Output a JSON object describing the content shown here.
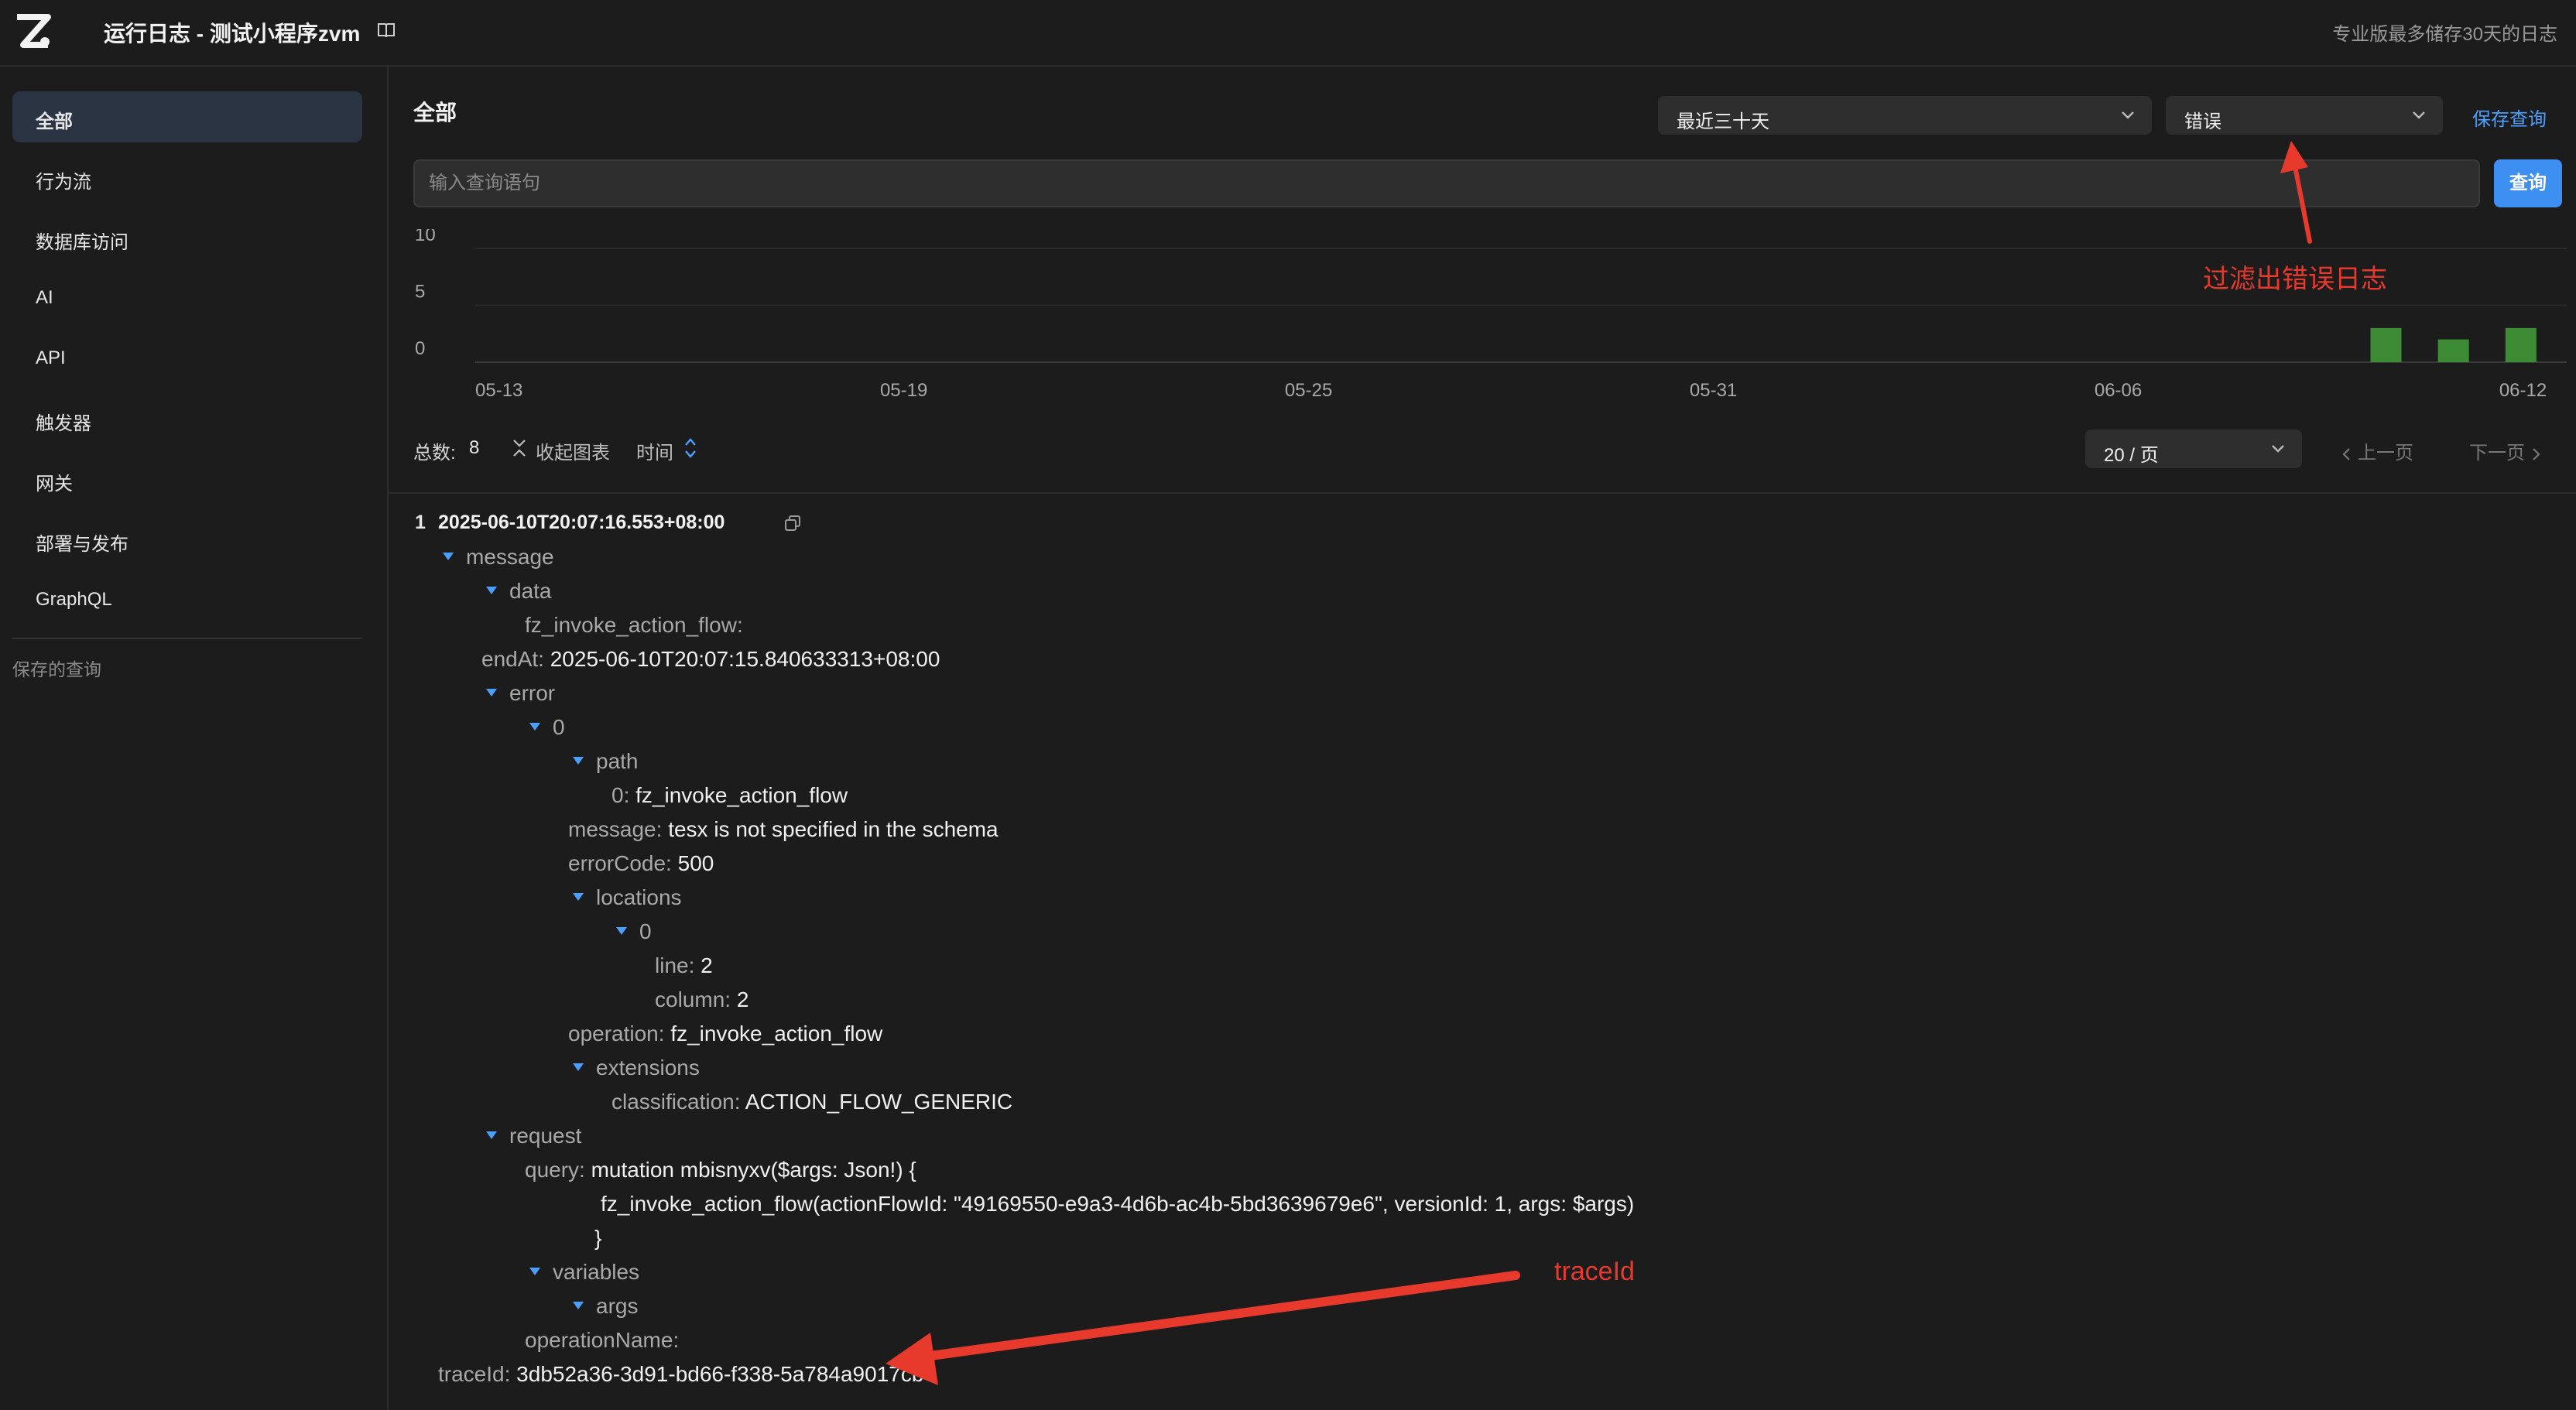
{
  "header": {
    "title": "运行日志 - 测试小程序zvm",
    "retention_note": "专业版最多储存30天的日志"
  },
  "sidebar": {
    "items": [
      {
        "label": "全部",
        "active": true
      },
      {
        "label": "行为流"
      },
      {
        "label": "数据库访问"
      },
      {
        "label": "AI"
      },
      {
        "label": "API"
      },
      {
        "label": "触发器"
      },
      {
        "label": "网关"
      },
      {
        "label": "部署与发布"
      },
      {
        "label": "GraphQL"
      }
    ],
    "saved_queries_label": "保存的查询"
  },
  "main": {
    "title": "全部",
    "time_range": "最近三十天",
    "level_filter": "错误",
    "save_query": "保存查询",
    "query_placeholder": "输入查询语句",
    "query_button": "查询"
  },
  "chart_data": {
    "type": "bar",
    "y_ticks": [
      "10",
      "5",
      "0"
    ],
    "ylim": [
      0,
      10
    ],
    "x_tick_labels": [
      "05-13",
      "05-19",
      "05-25",
      "05-31",
      "06-06",
      "06-12"
    ],
    "x_start": "05-13",
    "x_end": "06-13",
    "bars": [
      {
        "date": "06-10",
        "value": 3
      },
      {
        "date": "06-11",
        "value": 2
      },
      {
        "date": "06-12",
        "value": 3
      }
    ],
    "bar_color": "#3d8c35",
    "grid": true
  },
  "toolbar": {
    "total_label": "总数:",
    "total_count": "8",
    "collapse_chart": "收起图表",
    "time_sort": "时间",
    "page_size": "20 / 页",
    "prev_page": "上一页",
    "next_page": "下一页"
  },
  "annotations": {
    "filter_note": "过滤出错误日志",
    "trace_note": "traceId"
  },
  "log": {
    "index": "1",
    "timestamp": "2025-06-10T20:07:16.553+08:00",
    "k_message": "message",
    "k_data": "data",
    "k_fz_flow": "fz_invoke_action_flow:",
    "k_endAt": "endAt:",
    "v_endAt": "2025-06-10T20:07:15.840633313+08:00",
    "k_error": "error",
    "k_0": "0",
    "k_path": "path",
    "k_path0": "0:",
    "v_path0": "fz_invoke_action_flow",
    "k_err_message": "message:",
    "v_err_message": "tesx is not specified in the schema",
    "k_errorCode": "errorCode:",
    "v_errorCode": "500",
    "k_locations": "locations",
    "k_loc0": "0",
    "k_line": "line:",
    "v_line": "2",
    "k_column": "column:",
    "v_column": "2",
    "k_operation": "operation:",
    "v_operation": "fz_invoke_action_flow",
    "k_extensions": "extensions",
    "k_classification": "classification:",
    "v_classification": "ACTION_FLOW_GENERIC",
    "k_request": "request",
    "k_query": "query:",
    "v_query1": "mutation mbisnyxv($args: Json!) {",
    "v_query2": "fz_invoke_action_flow(actionFlowId: \"49169550-e9a3-4d6b-ac4b-5bd3639679e6\", versionId: 1, args: $args)",
    "v_query3": "}",
    "k_variables": "variables",
    "k_args": "args",
    "k_operationName": "operationName:",
    "k_traceId": "traceId:",
    "v_traceId": "3db52a36-3d91-bd66-f338-5a784a9017cb"
  }
}
